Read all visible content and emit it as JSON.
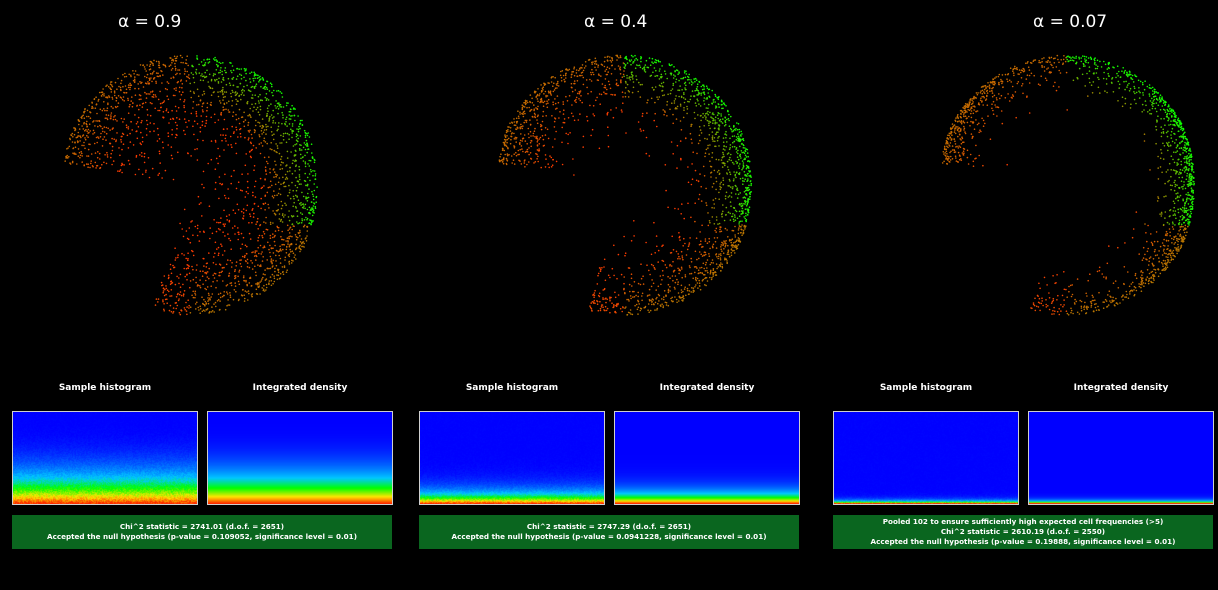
{
  "panels": [
    {
      "title": "α = 0.9",
      "histogram_label": "Sample histogram",
      "density_label": "Integrated density",
      "status_lines": [
        "Chi^2 statistic = 2741.01 (d.o.f. = 2651)",
        "Accepted the null hypothesis (p-value = 0.109052, significance level = 0.01)"
      ],
      "alpha": 0.9
    },
    {
      "title": "α = 0.4",
      "histogram_label": "Sample histogram",
      "density_label": "Integrated density",
      "status_lines": [
        "Chi^2 statistic = 2747.29 (d.o.f. = 2651)",
        "Accepted the null hypothesis (p-value = 0.0941228, significance level = 0.01)"
      ],
      "alpha": 0.4
    },
    {
      "title": "α = 0.07",
      "histogram_label": "Sample histogram",
      "density_label": "Integrated density",
      "status_lines": [
        "Pooled 102 to ensure sufficiently high expected cell frequencies (>5)",
        "Chi^2 statistic = 2610.19 (d.o.f. = 2550)",
        "Accepted the null hypothesis (p-value = 0.19888, significance level = 0.01)"
      ],
      "alpha": 0.07
    }
  ],
  "colors": {
    "background": "#000000",
    "status_bar": "#0a661f",
    "point_hot": "#00ff00",
    "point_cold": "#ff0000",
    "heatmap_low": "#0000ff"
  }
}
